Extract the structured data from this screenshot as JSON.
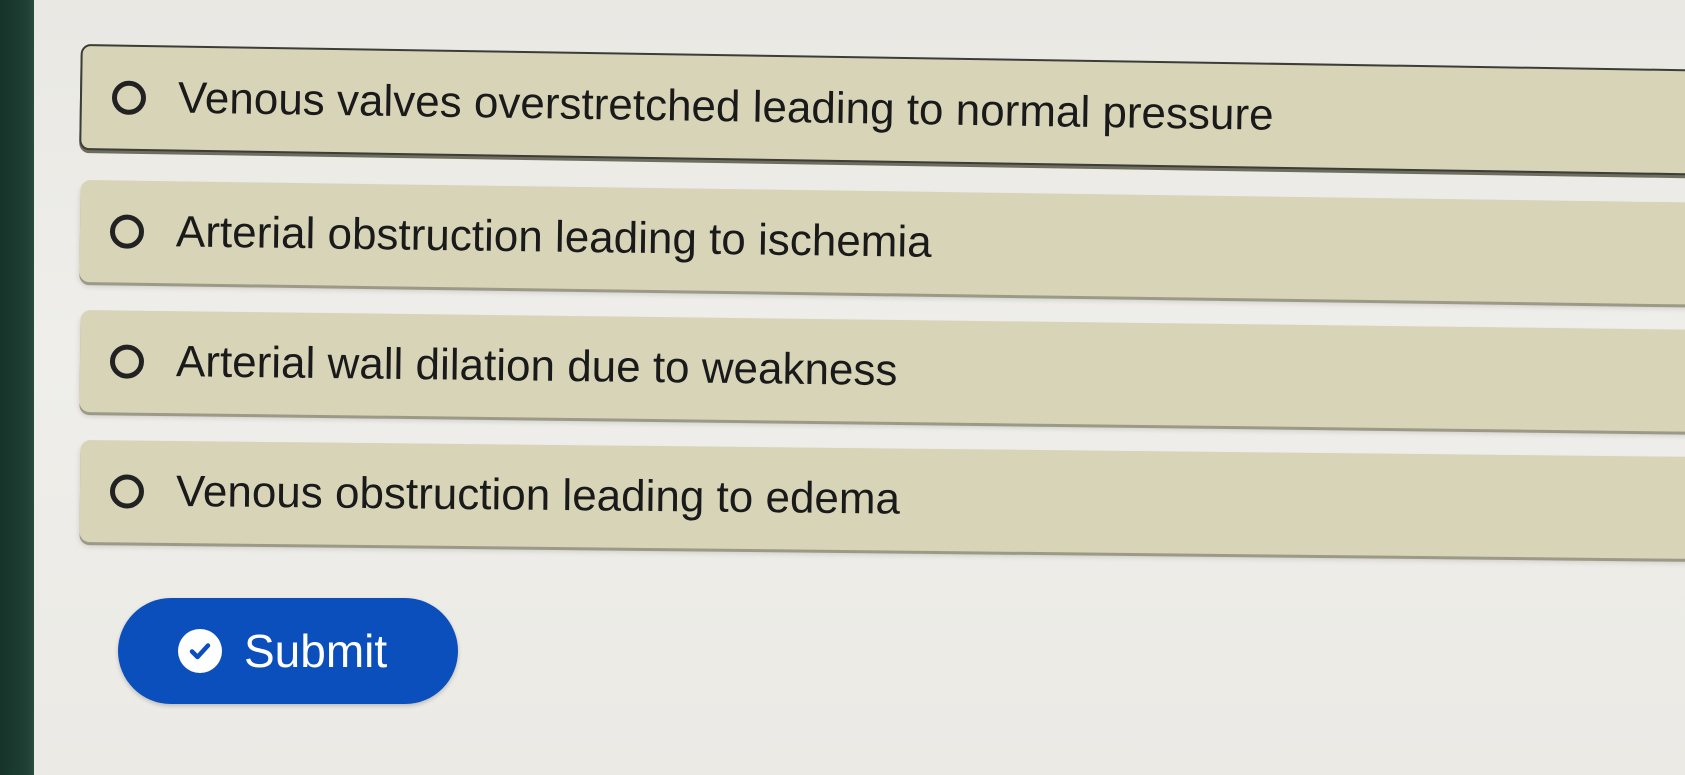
{
  "question": {
    "title_fragment": ""
  },
  "options": [
    {
      "label": "Venous valves overstretched leading to normal pressure"
    },
    {
      "label": "Arterial obstruction leading to ischemia"
    },
    {
      "label": "Arterial wall dilation due to weakness"
    },
    {
      "label": "Venous obstruction leading to edema"
    }
  ],
  "submit": {
    "label": "Submit",
    "icon": "check-circle-icon",
    "color": "#0b4fbd"
  },
  "colors": {
    "option_bg": "#d7d4b8",
    "page_bg": "#ecebe6"
  }
}
